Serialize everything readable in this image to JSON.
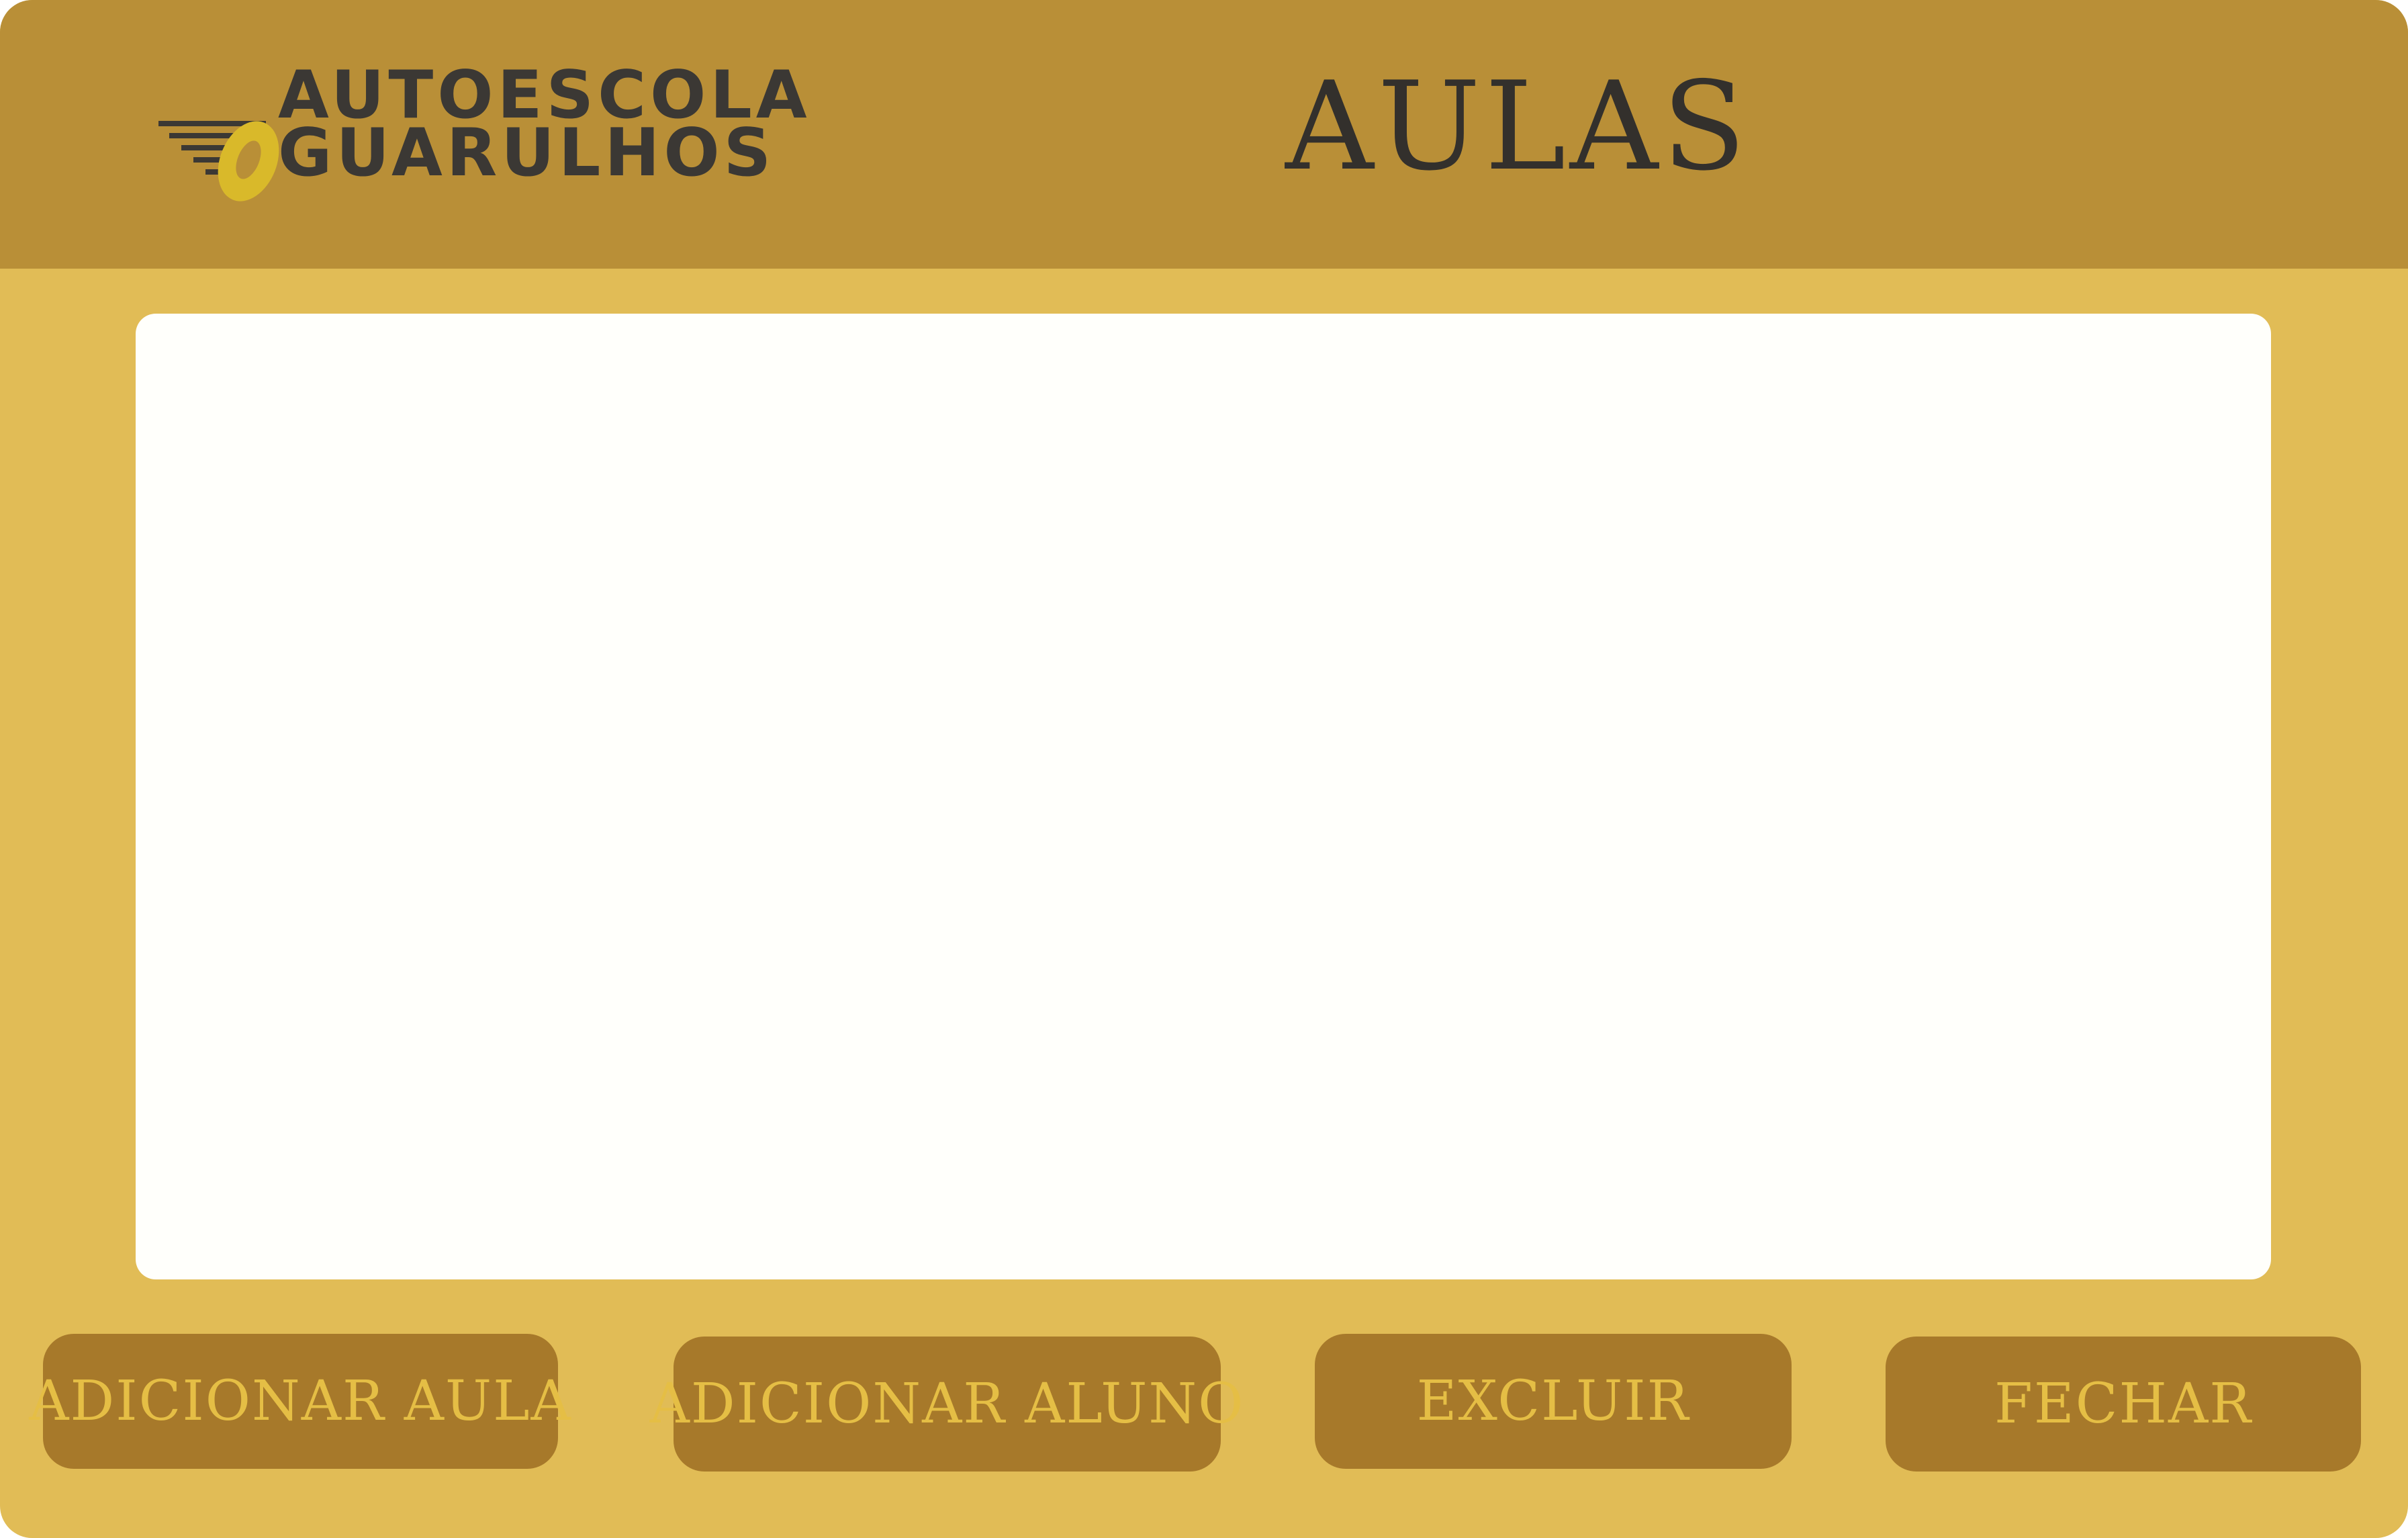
{
  "header": {
    "logo": {
      "line1": "AUTOESCOLA",
      "line2": "GUARULHOS",
      "icon": "car-wheel-wings-icon"
    },
    "title": "AULAS"
  },
  "content": {
    "rows": []
  },
  "actions": {
    "add_class_label": "ADICIONAR AULA",
    "add_student_label": "ADICIONAR ALUNO",
    "delete_label": "EXCLUIR",
    "close_label": "FECHAR"
  },
  "colors": {
    "header_bg": "#b98f37",
    "body_bg": "#e1bc56",
    "button_bg": "#a7792a",
    "button_text": "#e5be45",
    "panel_bg": "#fffffb",
    "logo_accent": "#d9b92a",
    "text_dark": "#33302c"
  }
}
